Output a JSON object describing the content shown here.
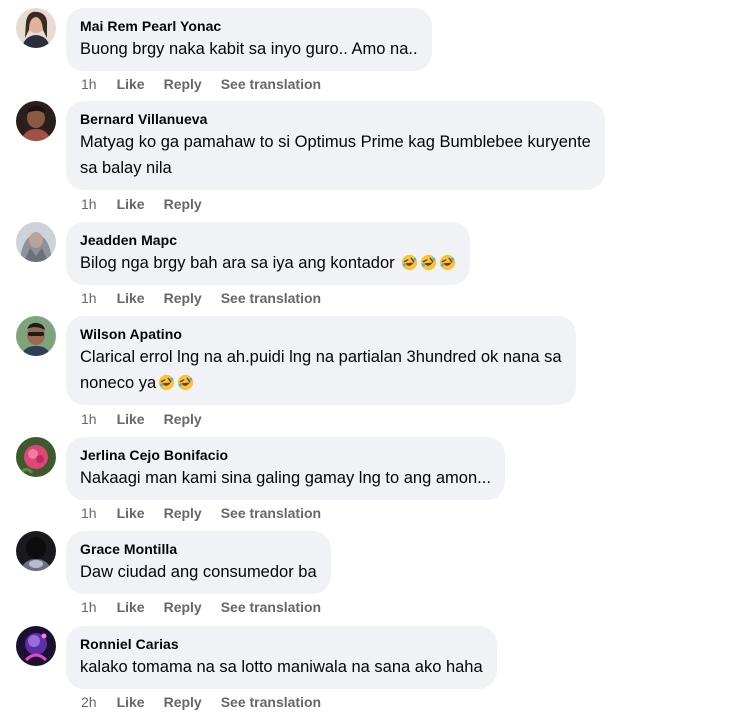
{
  "comments": [
    {
      "author": "Mai Rem Pearl Yonac",
      "text": "Buong brgy naka kabit sa inyo guro.. Amo na..",
      "emoji_count": 0,
      "time": "1h",
      "like_label": "Like",
      "reply_label": "Reply",
      "translate_label": "See translation",
      "avatar_color": "#c9b3a5"
    },
    {
      "author": "Bernard Villanueva",
      "text_line1": "Matyag ko ga pamahaw to si Optimus Prime kag Bumblebee kuryente",
      "text_line2": "sa balay nila",
      "emoji_count": 0,
      "time": "1h",
      "like_label": "Like",
      "reply_label": "Reply",
      "avatar_color": "#7a4a3a"
    },
    {
      "author": "Jeadden Mapc",
      "text": "Bilog nga brgy bah ara sa iya ang kontador",
      "emoji_count": 3,
      "time": "1h",
      "like_label": "Like",
      "reply_label": "Reply",
      "translate_label": "See translation",
      "avatar_color": "#a8aab0"
    },
    {
      "author": "Wilson Apatino",
      "text_line1": "Clarical errol lng na ah.puidi lng na partialan 3hundred ok nana sa",
      "text_line2": "noneco ya",
      "emoji_count": 2,
      "time": "1h",
      "like_label": "Like",
      "reply_label": "Reply",
      "avatar_color": "#6b8f6a"
    },
    {
      "author": "Jerlina Cejo Bonifacio",
      "text": "Nakaagi man kami sina galing gamay lng to ang amon...",
      "emoji_count": 0,
      "time": "1h",
      "like_label": "Like",
      "reply_label": "Reply",
      "translate_label": "See translation",
      "avatar_color": "#d94a7a"
    },
    {
      "author": "Grace Montilla",
      "text": "Daw ciudad ang consumedor ba",
      "emoji_count": 0,
      "time": "1h",
      "like_label": "Like",
      "reply_label": "Reply",
      "translate_label": "See translation",
      "avatar_color": "#2a2a2e"
    },
    {
      "author": "Ronniel Carias",
      "text": "kalako tomama na sa lotto maniwala na sana ako haha",
      "emoji_count": 0,
      "time": "2h",
      "like_label": "Like",
      "reply_label": "Reply",
      "translate_label": "See translation",
      "avatar_color": "#4a2a7a"
    }
  ],
  "colors": {
    "bubble_bg": "#f0f2f5",
    "meta_text": "#65676b",
    "body_text": "#050505"
  },
  "icons": {
    "reaction_emoji": "rolling-on-floor-laughing-emoji"
  }
}
